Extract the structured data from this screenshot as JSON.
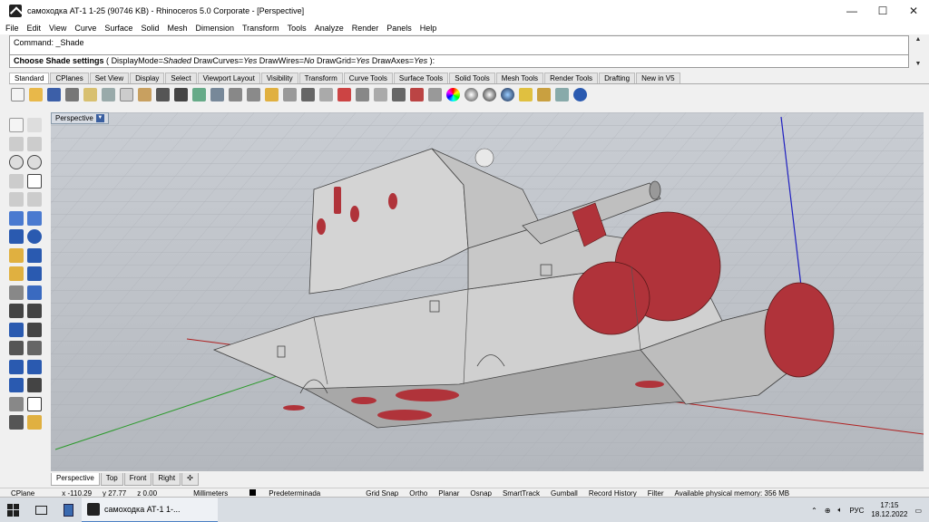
{
  "window": {
    "title": "самоходка АТ-1 1-25 (90746 KB) - Rhinoceros  5.0 Corporate - [Perspective]",
    "controls": [
      "—",
      "☐",
      "✕"
    ]
  },
  "menu": [
    "File",
    "Edit",
    "View",
    "Curve",
    "Surface",
    "Solid",
    "Mesh",
    "Dimension",
    "Transform",
    "Tools",
    "Analyze",
    "Render",
    "Panels",
    "Help"
  ],
  "command": {
    "history": "Command: _Shade",
    "prompt_label": "Choose Shade settings",
    "open": "(",
    "options": [
      {
        "name": "DisplayMode",
        "value": "Shaded"
      },
      {
        "name": "DrawCurves",
        "value": "Yes"
      },
      {
        "name": "DrawWires",
        "value": "No"
      },
      {
        "name": "DrawGrid",
        "value": "Yes"
      },
      {
        "name": "DrawAxes",
        "value": "Yes"
      }
    ],
    "close": "):"
  },
  "toolbar_tabs": [
    "Standard",
    "CPlanes",
    "Set View",
    "Display",
    "Select",
    "Viewport Layout",
    "Visibility",
    "Transform",
    "Curve Tools",
    "Surface Tools",
    "Solid Tools",
    "Mesh Tools",
    "Render Tools",
    "Drafting",
    "New in V5"
  ],
  "active_toolbar_tab": "Standard",
  "viewport": {
    "name": "Perspective",
    "tabs": [
      "Perspective",
      "Top",
      "Front",
      "Right"
    ],
    "add_tab": "✣"
  },
  "status": {
    "cplane": "CPlane",
    "x": "x -110.29",
    "y": "y 27.77",
    "z": "z 0.00",
    "units": "Millimeters",
    "layer": "Predeterminada",
    "toggles": [
      "Grid Snap",
      "Ortho",
      "Planar",
      "Osnap",
      "SmartTrack",
      "Gumball",
      "Record History",
      "Filter"
    ],
    "memory": "Available physical memory: 356 MB"
  },
  "taskbar": {
    "task_label": "самоходка АТ-1 1-...",
    "lang": "РУС",
    "time": "17:15",
    "date": "18.12.2022"
  },
  "colors": {
    "model_gray": "#c8c8c8",
    "model_red": "#b0333a",
    "axis_red": "#b02020",
    "axis_green": "#2a9a2a",
    "axis_blue": "#2020c0"
  }
}
